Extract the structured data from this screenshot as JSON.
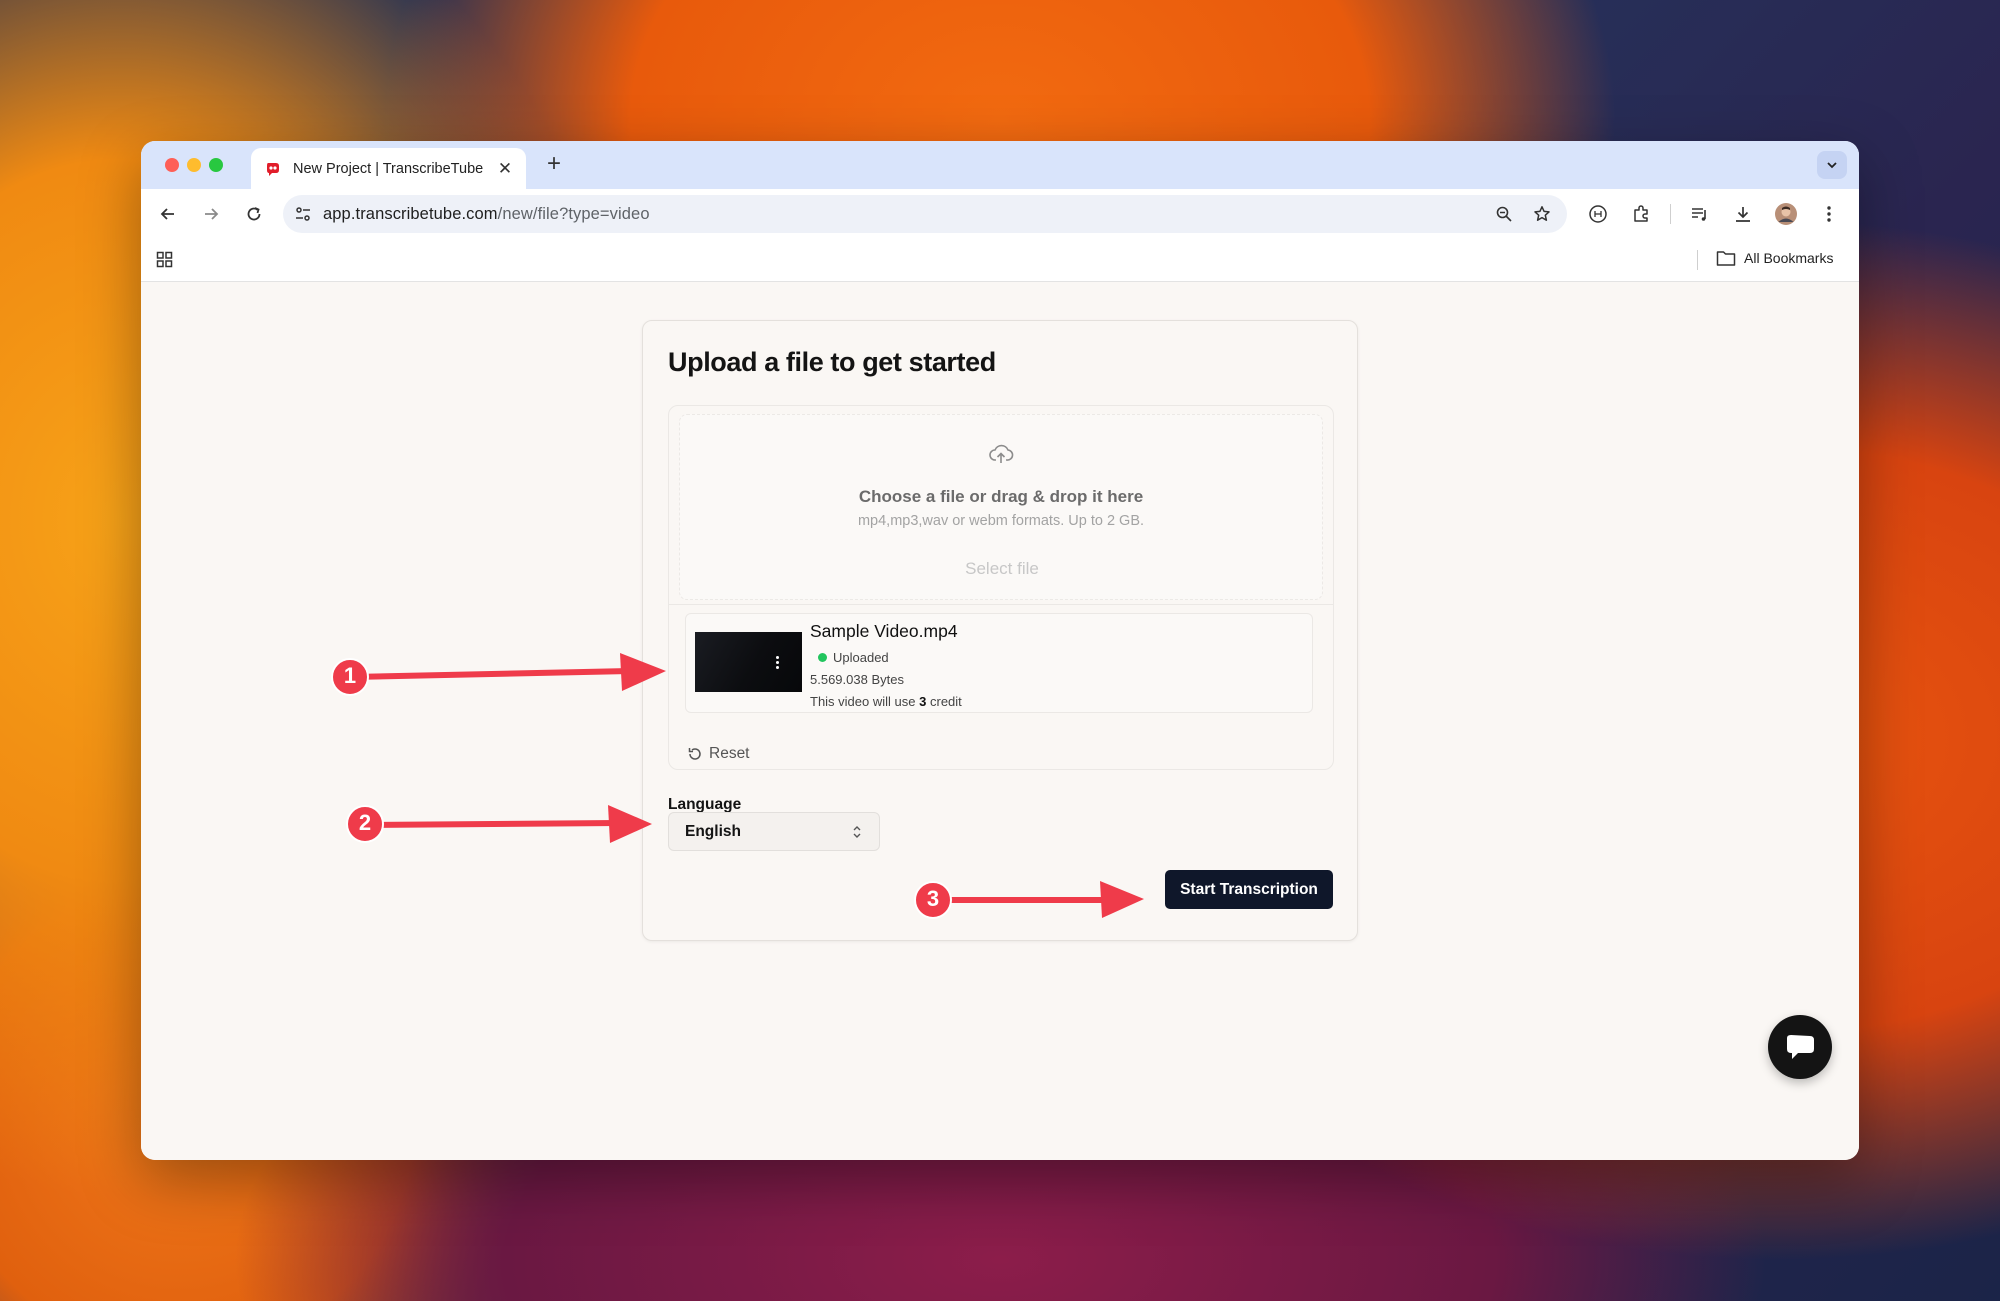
{
  "browser": {
    "tab_title": "New Project | TranscribeTube",
    "url_host": "app.transcribetube.com",
    "url_path": "/new/file?type=video",
    "bookmarks_label": "All Bookmarks"
  },
  "upload": {
    "title": "Upload a file to get started",
    "dropzone_title": "Choose a file or drag & drop it here",
    "dropzone_subtitle": "mp4,mp3,wav or webm formats. Up to 2 GB.",
    "select_button": "Select file",
    "file": {
      "name": "Sample Video.mp4",
      "status": "Uploaded",
      "size": "5.569.038 Bytes",
      "credit_prefix": "This video will use",
      "credit_count": "3",
      "credit_suffix": "credit"
    },
    "reset_label": "Reset"
  },
  "language": {
    "label": "Language",
    "selected": "English"
  },
  "actions": {
    "start_label": "Start Transcription"
  },
  "annotations": [
    "1",
    "2",
    "3"
  ],
  "colors": {
    "accent_dark": "#0f172a",
    "status_green": "#22c55e",
    "annotation_red": "#ef3b4a"
  }
}
